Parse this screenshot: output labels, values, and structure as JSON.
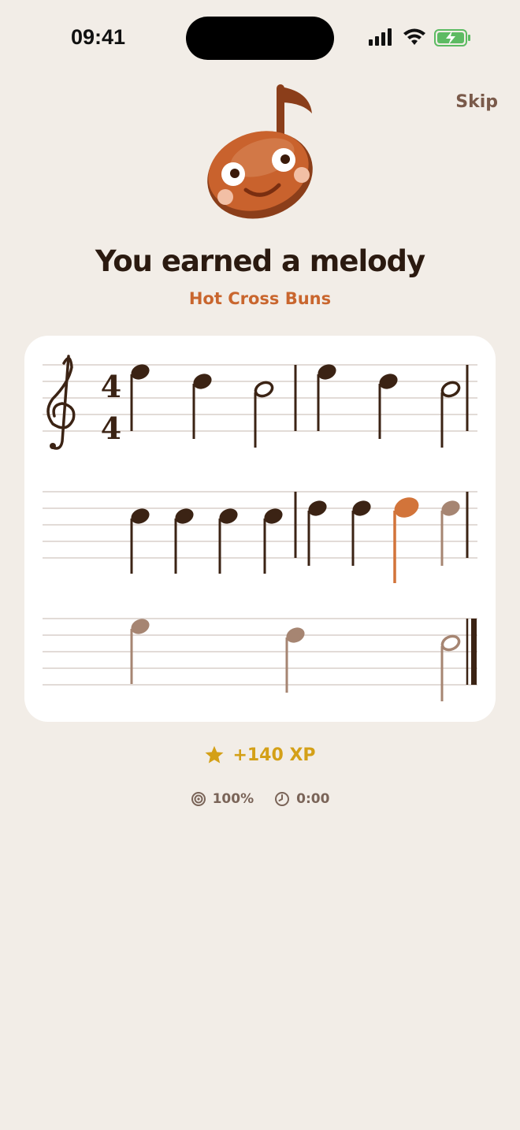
{
  "status_bar": {
    "time": "09:41",
    "icons": [
      "signal-icon",
      "wifi-icon",
      "battery-charging-icon"
    ]
  },
  "header": {
    "skip_label": "Skip"
  },
  "mascot": {
    "icon": "music-note-mascot-icon"
  },
  "reward": {
    "title": "You earned a melody",
    "song_name": "Hot Cross Buns"
  },
  "score": {
    "clef": "treble",
    "time_signature": {
      "top": "4",
      "bottom": "4"
    },
    "colors": {
      "played": "#3B2314",
      "current": "#D2743A",
      "upcoming": "#A68572",
      "staff_line": "#D8CFCA"
    },
    "systems": [
      {
        "notes": [
          {
            "pitch": "B4",
            "duration": "quarter",
            "state": "played"
          },
          {
            "pitch": "A4",
            "duration": "quarter",
            "state": "played"
          },
          {
            "pitch": "G4",
            "duration": "half",
            "state": "played"
          },
          {
            "bar": true
          },
          {
            "pitch": "B4",
            "duration": "quarter",
            "state": "played"
          },
          {
            "pitch": "A4",
            "duration": "quarter",
            "state": "played"
          },
          {
            "pitch": "G4",
            "duration": "half",
            "state": "played"
          }
        ]
      },
      {
        "notes": [
          {
            "pitch": "G4",
            "duration": "quarter",
            "state": "played"
          },
          {
            "pitch": "G4",
            "duration": "quarter",
            "state": "played"
          },
          {
            "pitch": "G4",
            "duration": "quarter",
            "state": "played"
          },
          {
            "pitch": "G4",
            "duration": "quarter",
            "state": "played"
          },
          {
            "bar": true
          },
          {
            "pitch": "A4",
            "duration": "quarter",
            "state": "played"
          },
          {
            "pitch": "A4",
            "duration": "quarter",
            "state": "played"
          },
          {
            "pitch": "A4",
            "duration": "quarter",
            "state": "current"
          },
          {
            "pitch": "A4",
            "duration": "quarter",
            "state": "upcoming"
          }
        ]
      },
      {
        "notes": [
          {
            "pitch": "B4",
            "duration": "quarter",
            "state": "upcoming"
          },
          {
            "pitch": "A4",
            "duration": "quarter",
            "state": "upcoming"
          },
          {
            "pitch": "G4",
            "duration": "half",
            "state": "upcoming"
          },
          {
            "final_bar": true
          }
        ]
      }
    ]
  },
  "xp": {
    "icon": "star-icon",
    "label": "+140 XP"
  },
  "stats": {
    "accuracy": {
      "icon": "target-icon",
      "value": "100%"
    },
    "time": {
      "icon": "clock-icon",
      "value": "0:00"
    }
  }
}
